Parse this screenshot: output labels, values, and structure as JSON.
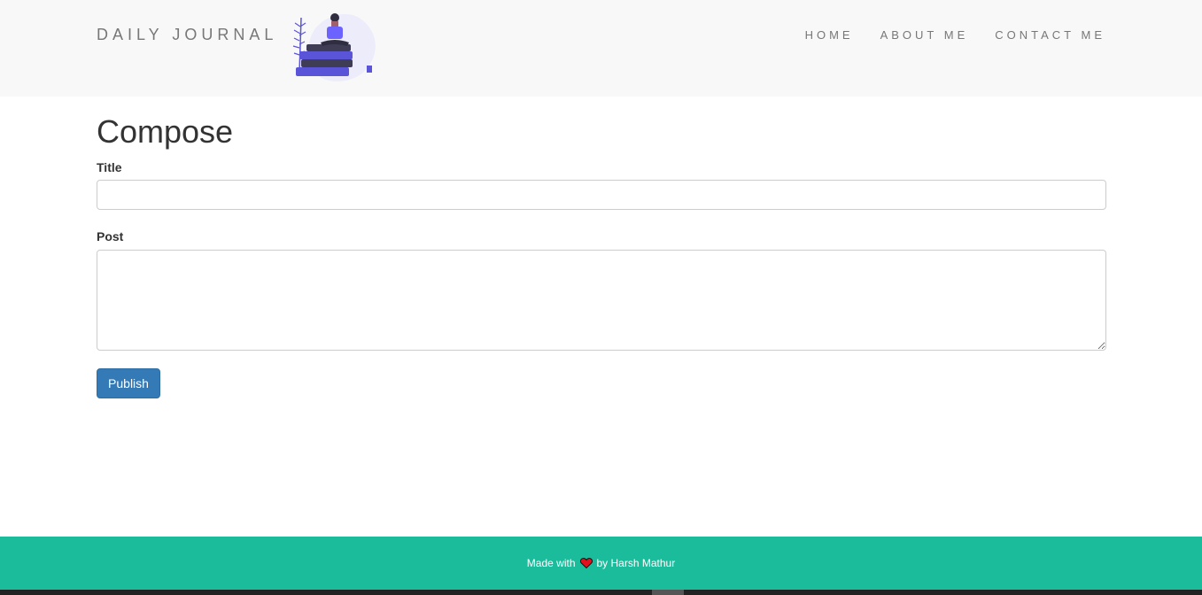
{
  "navbar": {
    "brand": "DAILY JOURNAL",
    "illustration": "girl-reading-on-books-illustration",
    "links": [
      "HOME",
      "ABOUT ME",
      "CONTACT ME"
    ]
  },
  "compose": {
    "heading": "Compose",
    "title_label": "Title",
    "title_value": "",
    "post_label": "Post",
    "post_value": "",
    "publish_label": "Publish"
  },
  "footer": {
    "prefix": "Made with",
    "icon": "heart-icon",
    "suffix": "by Harsh Mathur"
  },
  "colors": {
    "navbar_bg": "#f8f8f8",
    "footer_bg": "#1abc9c",
    "button_bg": "#337ab7",
    "heart": "#e0101e"
  }
}
